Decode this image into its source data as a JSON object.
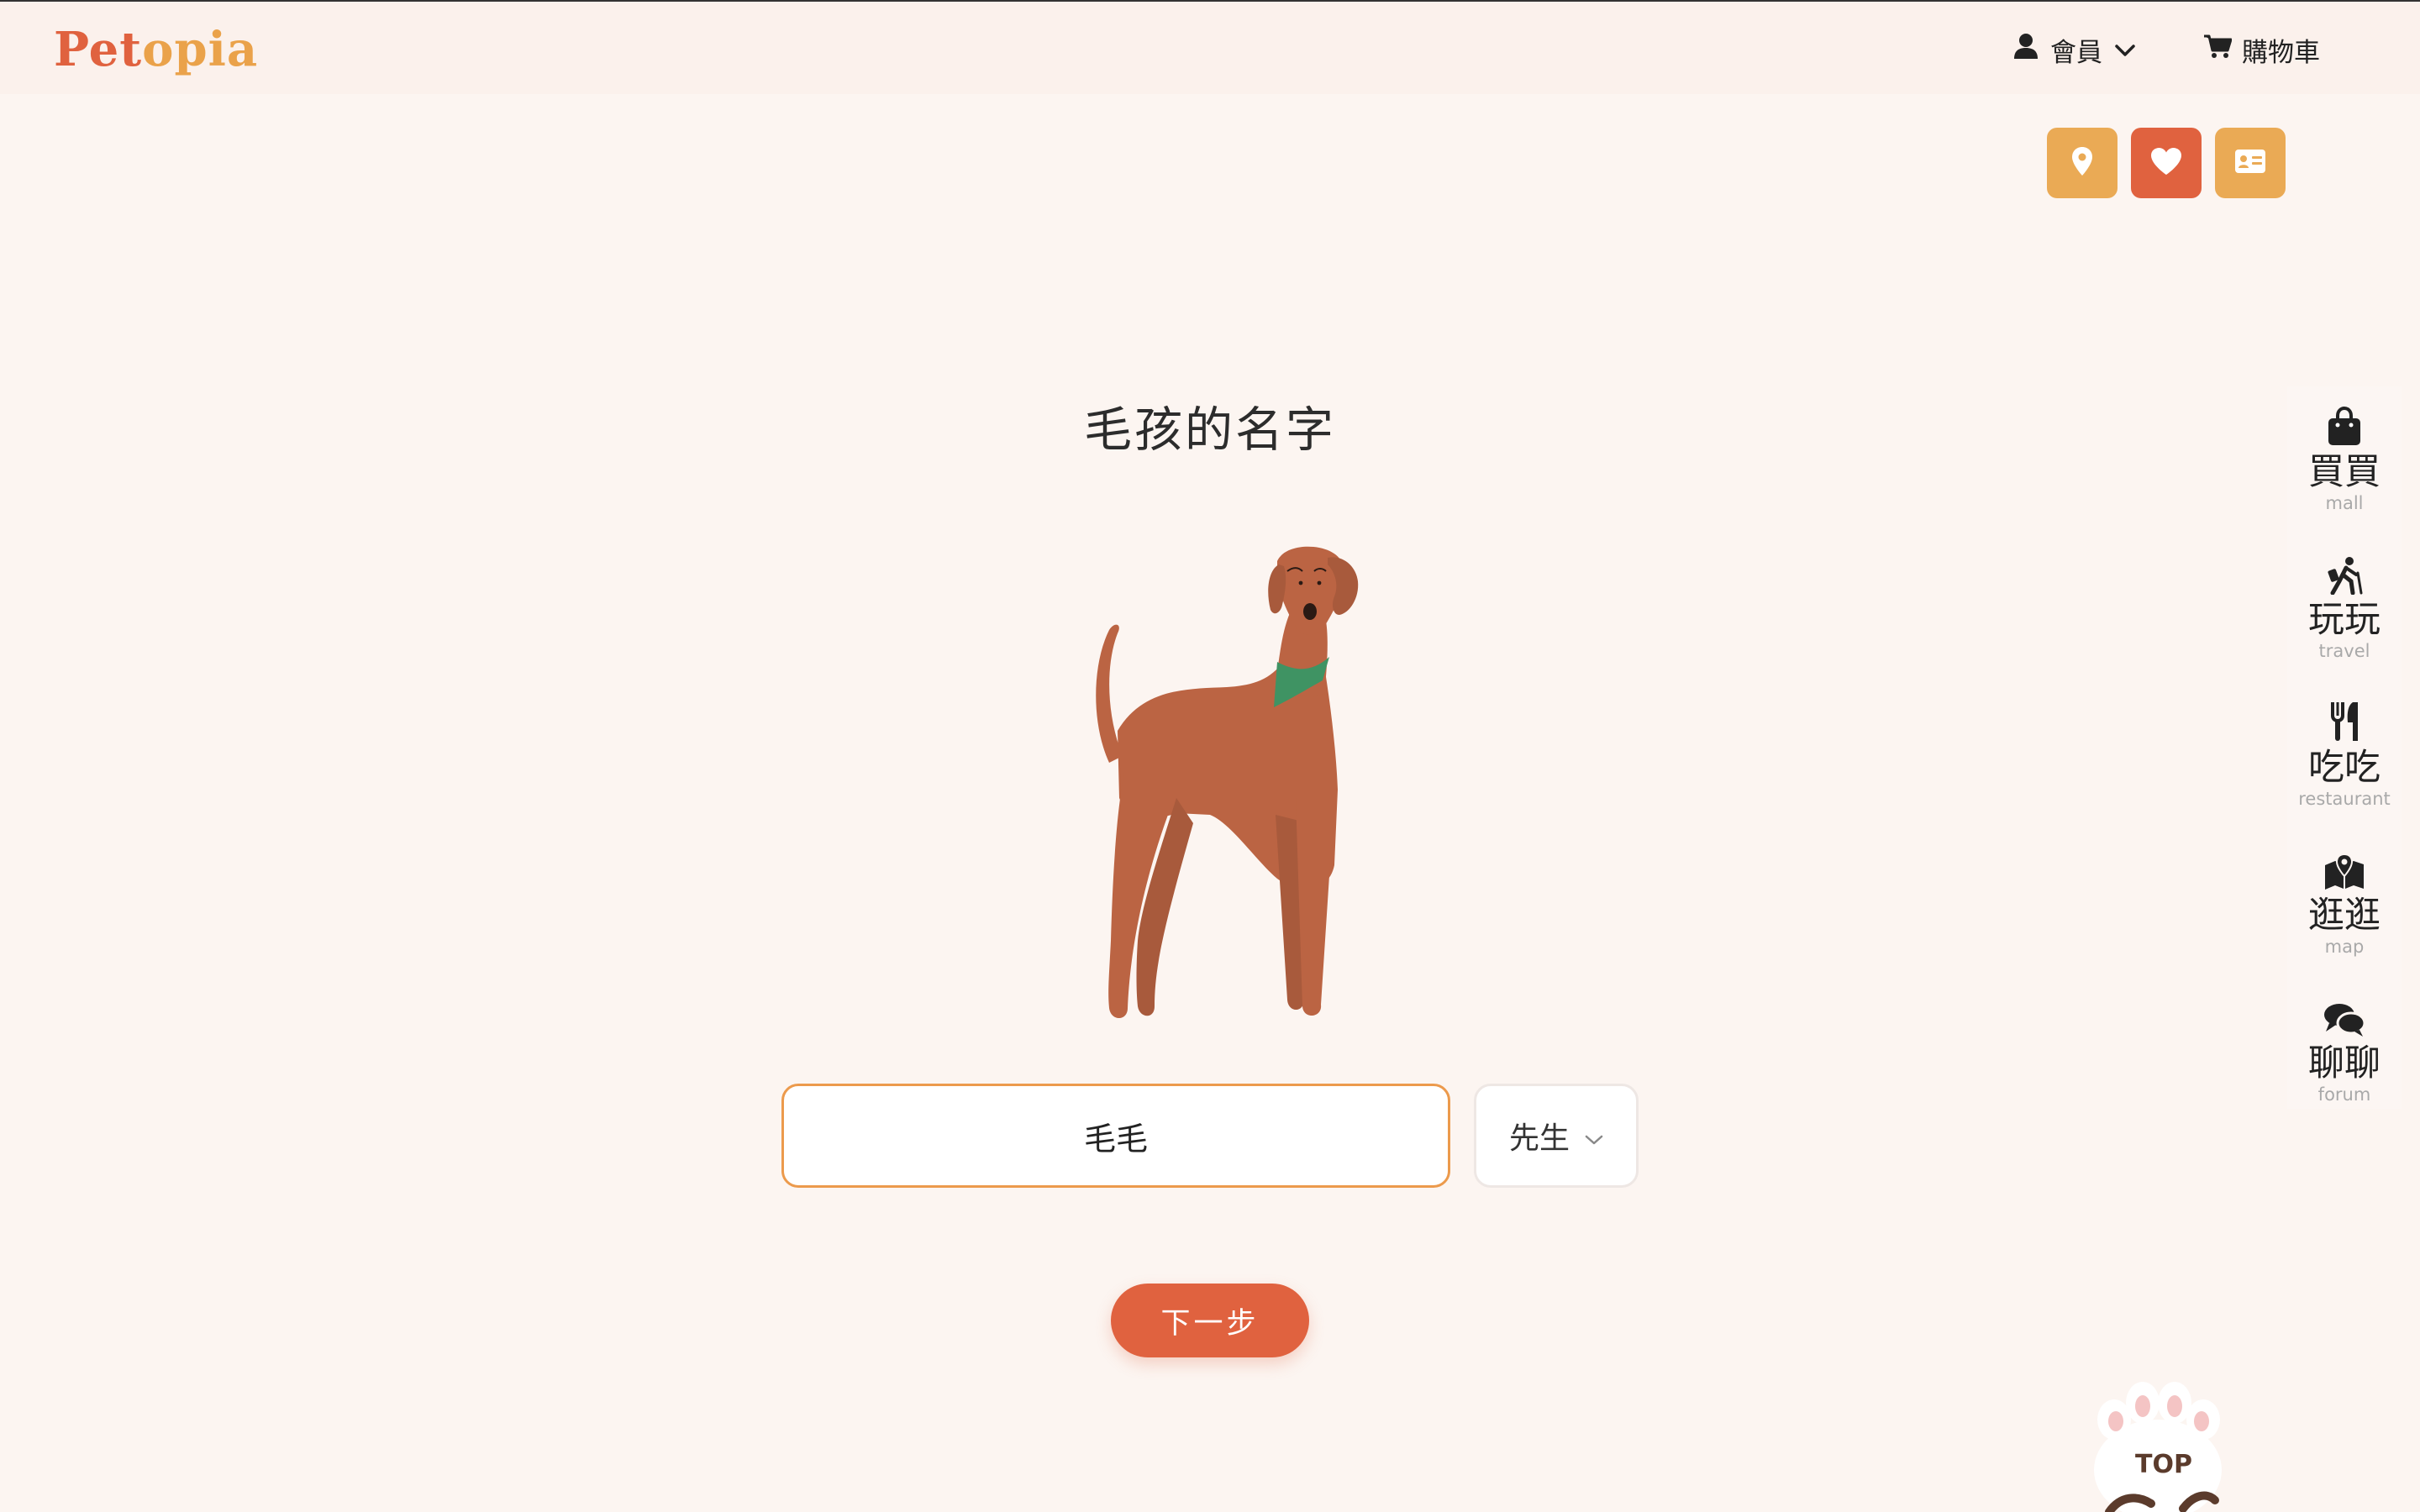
{
  "header": {
    "logo_part1": "Pet",
    "logo_part2": "opia",
    "member_label": "會員",
    "cart_label": "購物車"
  },
  "quick_buttons": [
    {
      "icon": "location-pin-icon",
      "color": "#eaaa55"
    },
    {
      "icon": "heart-icon",
      "color": "#e0623f"
    },
    {
      "icon": "id-card-icon",
      "color": "#eaaa55"
    }
  ],
  "side_nav": {
    "items": [
      {
        "zh": "買買",
        "en": "mall",
        "icon": "shopping-bag-icon"
      },
      {
        "zh": "玩玩",
        "en": "travel",
        "icon": "hiking-icon"
      },
      {
        "zh": "吃吃",
        "en": "restaurant",
        "icon": "utensils-icon"
      },
      {
        "zh": "逛逛",
        "en": "map",
        "icon": "map-icon"
      },
      {
        "zh": "聊聊",
        "en": "forum",
        "icon": "chat-icon"
      }
    ]
  },
  "main": {
    "title": "毛孩的名字",
    "name_value": "毛毛",
    "title_select_value": "先生",
    "next_label": "下一步"
  },
  "top_button": {
    "label": "TOP"
  },
  "colors": {
    "accent": "#e0623f",
    "secondary": "#eaaa55",
    "input_border": "#ec9a4c",
    "background": "#fcf5f1"
  }
}
